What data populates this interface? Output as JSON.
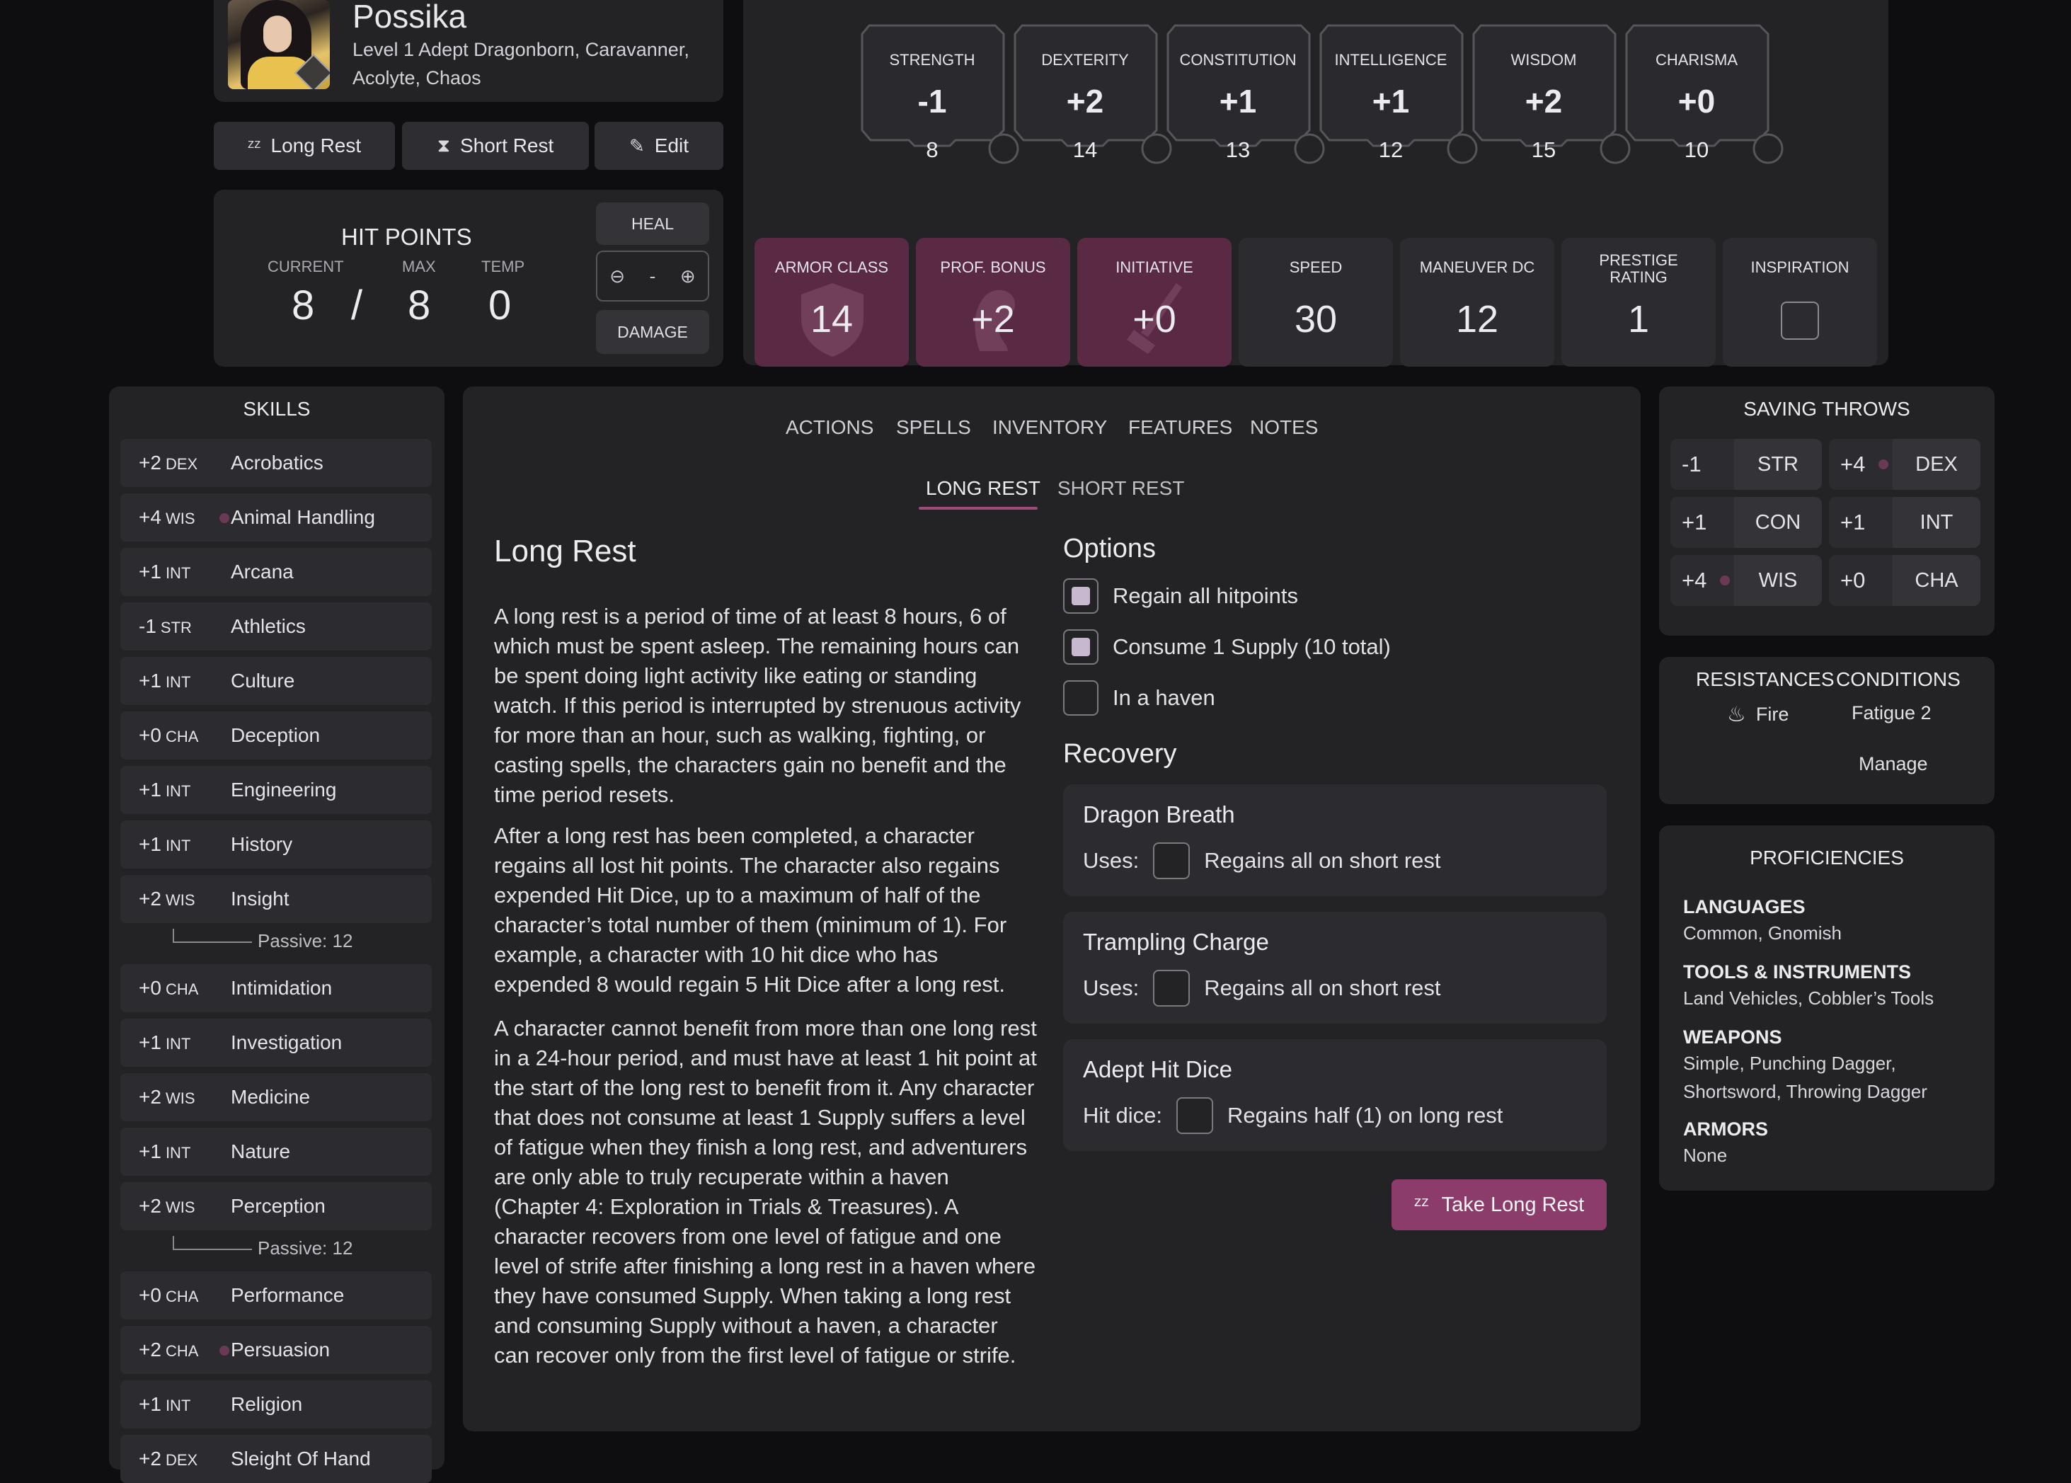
{
  "character": {
    "name": "Possika",
    "subtitle": "Level 1 Adept Dragonborn, Caravanner, Acolyte, Chaos"
  },
  "header_buttons": {
    "long_rest": "Long Rest",
    "short_rest": "Short Rest",
    "edit": "Edit"
  },
  "hit_points": {
    "title": "HIT POINTS",
    "current_label": "CURRENT",
    "max_label": "MAX",
    "temp_label": "TEMP",
    "current": "8",
    "separator": "/",
    "max": "8",
    "temp": "0",
    "heal": "HEAL",
    "damage": "DAMAGE",
    "input_value": "-"
  },
  "abilities": [
    {
      "name": "STRENGTH",
      "mod": "-1",
      "score": "8"
    },
    {
      "name": "DEXTERITY",
      "mod": "+2",
      "score": "14"
    },
    {
      "name": "CONSTITUTION",
      "mod": "+1",
      "score": "13"
    },
    {
      "name": "INTELLIGENCE",
      "mod": "+1",
      "score": "12"
    },
    {
      "name": "WISDOM",
      "mod": "+2",
      "score": "15"
    },
    {
      "name": "CHARISMA",
      "mod": "+0",
      "score": "10"
    }
  ],
  "stats": [
    {
      "label": "ARMOR CLASS",
      "value": "14"
    },
    {
      "label": "PROF. BONUS",
      "value": "+2"
    },
    {
      "label": "INITIATIVE",
      "value": "+0"
    },
    {
      "label": "SPEED",
      "value": "30"
    },
    {
      "label": "MANEUVER DC",
      "value": "12"
    },
    {
      "label": "PRESTIGE RATING",
      "value": "1"
    },
    {
      "label": "INSPIRATION",
      "value": ""
    }
  ],
  "skills": {
    "title": "SKILLS",
    "items": [
      {
        "mod": "+2",
        "ability": "DEX",
        "name": "Acrobatics"
      },
      {
        "mod": "+4",
        "ability": "WIS",
        "name": "Animal Handling"
      },
      {
        "mod": "+1",
        "ability": "INT",
        "name": "Arcana"
      },
      {
        "mod": "-1",
        "ability": "STR",
        "name": "Athletics"
      },
      {
        "mod": "+1",
        "ability": "INT",
        "name": "Culture"
      },
      {
        "mod": "+0",
        "ability": "CHA",
        "name": "Deception"
      },
      {
        "mod": "+1",
        "ability": "INT",
        "name": "Engineering"
      },
      {
        "mod": "+1",
        "ability": "INT",
        "name": "History"
      },
      {
        "mod": "+2",
        "ability": "WIS",
        "name": "Insight"
      },
      {
        "mod": "+0",
        "ability": "CHA",
        "name": "Intimidation"
      },
      {
        "mod": "+1",
        "ability": "INT",
        "name": "Investigation"
      },
      {
        "mod": "+2",
        "ability": "WIS",
        "name": "Medicine"
      },
      {
        "mod": "+1",
        "ability": "INT",
        "name": "Nature"
      },
      {
        "mod": "+2",
        "ability": "WIS",
        "name": "Perception"
      },
      {
        "mod": "+0",
        "ability": "CHA",
        "name": "Performance"
      },
      {
        "mod": "+2",
        "ability": "CHA",
        "name": "Persuasion"
      },
      {
        "mod": "+1",
        "ability": "INT",
        "name": "Religion"
      },
      {
        "mod": "+2",
        "ability": "DEX",
        "name": "Sleight Of Hand"
      }
    ],
    "passive_insight": "Passive: 12",
    "passive_perception": "Passive: 12"
  },
  "tabs": [
    "ACTIONS",
    "SPELLS",
    "INVENTORY",
    "FEATURES",
    "NOTES"
  ],
  "subtabs": [
    "LONG REST",
    "SHORT REST"
  ],
  "long_rest": {
    "heading": "Long Rest",
    "paragraphs": [
      "A long rest is a period of time of at least 8 hours, 6 of which must be spent asleep. The remaining hours can be spent doing light activity like eating or standing watch. If this period is interrupted by strenuous activity for more than an hour, such as walking, fighting, or casting spells, the characters gain no benefit and the time period resets.",
      "After a long rest has been completed, a character regains all lost hit points. The character also regains expended Hit Dice, up to a maximum of half of the character’s total number of them (minimum of 1). For example, a character with 10 hit dice who has expended 8 would regain 5 Hit Dice after a long rest.",
      "A character cannot benefit from more than one long rest in a 24-hour period, and must have at least 1 hit point at the start of the long rest to benefit from it. Any character that does not consume at least 1 Supply suffers a level of fatigue when they finish a long rest, and adventurers are only able to truly recuperate within a haven (Chapter 4: Exploration in Trials & Treasures). A character recovers from one level of fatigue and one level of strife after finishing a long rest in a haven where they have consumed Supply. When taking a long rest and consuming Supply without a haven, a character can recover only from the first level of fatigue or strife."
    ],
    "options_heading": "Options",
    "options": [
      {
        "label": "Regain all hitpoints",
        "checked": true
      },
      {
        "label": "Consume 1 Supply (10 total)",
        "checked": true
      },
      {
        "label": "In a haven",
        "checked": false
      }
    ],
    "recovery_heading": "Recovery",
    "recovery": [
      {
        "title": "Dragon Breath",
        "field": "Uses:",
        "note": "Regains all on short rest"
      },
      {
        "title": "Trampling Charge",
        "field": "Uses:",
        "note": "Regains all on short rest"
      },
      {
        "title": "Adept Hit Dice",
        "field": "Hit dice:",
        "note": "Regains half (1) on long rest"
      }
    ],
    "take_button": "Take Long Rest"
  },
  "saving_throws": {
    "title": "SAVING THROWS",
    "items": [
      {
        "mod": "-1",
        "ability": "STR",
        "proficient": false
      },
      {
        "mod": "+4",
        "ability": "DEX",
        "proficient": true
      },
      {
        "mod": "+1",
        "ability": "CON",
        "proficient": false
      },
      {
        "mod": "+1",
        "ability": "INT",
        "proficient": false
      },
      {
        "mod": "+4",
        "ability": "WIS",
        "proficient": true
      },
      {
        "mod": "+0",
        "ability": "CHA",
        "proficient": false
      }
    ]
  },
  "resistances": {
    "title": "RESISTANCES",
    "items": [
      "Fire"
    ]
  },
  "conditions": {
    "title": "CONDITIONS",
    "items": [
      "Fatigue 2"
    ],
    "manage": "Manage"
  },
  "proficiencies": {
    "title": "PROFICIENCIES",
    "languages_title": "LANGUAGES",
    "languages": "Common, Gnomish",
    "tools_title": "TOOLS & INSTRUMENTS",
    "tools": "Land Vehicles, Cobbler’s Tools",
    "weapons_title": "WEAPONS",
    "weapons": "Simple, Punching Dagger, Shortsword, Throwing Dagger",
    "armors_title": "ARMORS",
    "armors": "None"
  },
  "colors": {
    "background": "#0e0e10",
    "panel": "#232326",
    "tile": "#2c2c30",
    "accent": "#8c3c6a",
    "highlight_tile": "#5a2a45"
  }
}
